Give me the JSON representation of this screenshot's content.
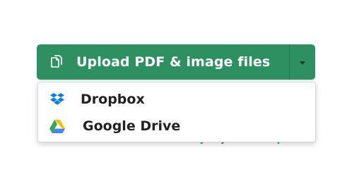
{
  "upload": {
    "label": "Upload PDF & image files",
    "icon": "files-icon",
    "toggle_icon": "caret-down-icon",
    "color": "#2e9061"
  },
  "behind_text": "Rather work offline? Try Sejda Desktop",
  "menu": {
    "items": [
      {
        "label": "Dropbox",
        "icon": "dropbox-icon"
      },
      {
        "label": "Google Drive",
        "icon": "google-drive-icon"
      }
    ]
  }
}
